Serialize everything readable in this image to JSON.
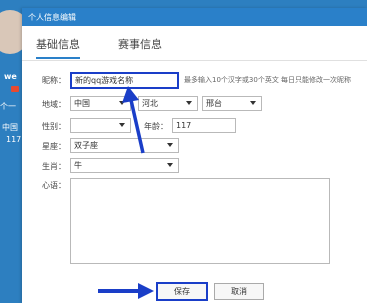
{
  "background": {
    "name_fragment": "we",
    "line1": "个一",
    "line2": "中国",
    "line3": "117"
  },
  "dialog": {
    "title": "个人信息编辑",
    "tabs": [
      {
        "label": "基础信息",
        "active": true
      },
      {
        "label": "赛事信息",
        "active": false
      }
    ],
    "fields": {
      "nickname": {
        "label": "昵称：",
        "value": "新的qq游戏名称",
        "hint": "最多输入10个汉字或30个英文 每日只能修改一次昵称"
      },
      "region": {
        "label": "地域：",
        "country": "中国",
        "province": "河北",
        "city": "邢台"
      },
      "gender": {
        "label": "性别：",
        "value": ""
      },
      "age": {
        "label": "年龄：",
        "value": "117"
      },
      "constellation": {
        "label": "星座：",
        "value": "双子座"
      },
      "zodiac": {
        "label": "生肖：",
        "value": "牛"
      },
      "mood": {
        "label": "心语：",
        "value": ""
      }
    },
    "buttons": {
      "save": "保存",
      "cancel": "取消"
    }
  },
  "colors": {
    "accent": "#2a80c9",
    "annotation": "#1a3ec8"
  }
}
